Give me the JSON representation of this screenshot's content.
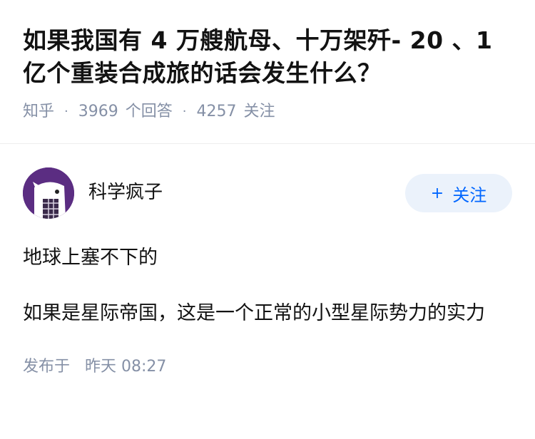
{
  "question": {
    "title": "如果我国有 4 万艘航母、十万架歼- 20 、1 亿个重装合成旅的话会发生什么？",
    "source": "知乎",
    "answer_count": "3969",
    "answer_label": "个回答",
    "follow_count": "4257",
    "follow_label": "关注"
  },
  "answer": {
    "author_name": "科学疯子",
    "follow_button": "关注",
    "paragraphs": [
      "地球上塞不下的",
      "如果是星际帝国，这是一个正常的小型星际势力的实力"
    ],
    "publish_label": "发布于",
    "publish_time": "昨天 08:27"
  },
  "colors": {
    "accent": "#0066ff",
    "follow_button_bg": "#ebf2fb",
    "meta_text": "#8590a6",
    "avatar_bg": "#5b2d82"
  },
  "icons": {
    "avatar": "avatar-icon",
    "plus": "plus-icon"
  }
}
